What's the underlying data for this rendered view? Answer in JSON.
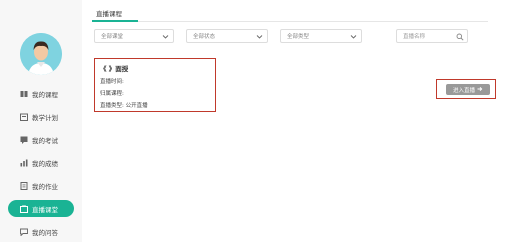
{
  "sidebar": {
    "items": [
      {
        "label": "我的课程",
        "icon": "book-icon"
      },
      {
        "label": "教学计划",
        "icon": "calendar-icon"
      },
      {
        "label": "我的考试",
        "icon": "exam-icon"
      },
      {
        "label": "我的成绩",
        "icon": "chart-icon"
      },
      {
        "label": "我的作业",
        "icon": "homework-icon"
      },
      {
        "label": "直播课堂",
        "icon": "live-icon"
      },
      {
        "label": "我的问答",
        "icon": "qa-icon"
      }
    ],
    "active_index": 5,
    "accent": "#1ab394"
  },
  "header": {
    "tab_label": "直播课程"
  },
  "filters": {
    "course": "全部课堂",
    "status": "全部状态",
    "type": "全部类型",
    "search_placeholder": "直播名称"
  },
  "live_item": {
    "title": "《  》面授",
    "time_label": "直播时间:",
    "course_label": "归属课程:",
    "type_label": "直播类型: 公开直播"
  },
  "enter_button": {
    "label": "进入直播"
  }
}
